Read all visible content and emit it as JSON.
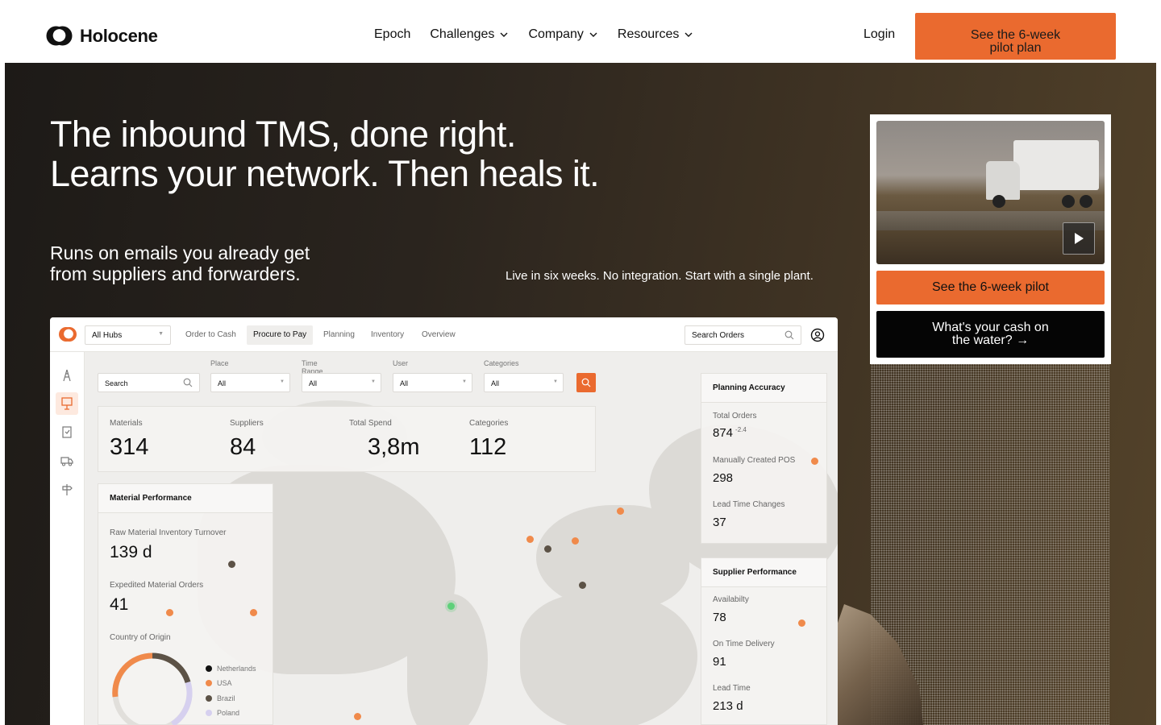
{
  "brand": {
    "name": "Holocene"
  },
  "nav": {
    "links": [
      {
        "label": "Epoch"
      },
      {
        "label": "Challenges"
      },
      {
        "label": "Company"
      },
      {
        "label": "Resources"
      }
    ],
    "login": "Login",
    "cta": [
      "See the 6-week",
      "pilot plan"
    ]
  },
  "hero": {
    "headline": [
      "The inbound TMS, done right.",
      "Learns your network. Then heals it."
    ],
    "sub_left": [
      "Runs on emails you already get",
      "from suppliers and forwarders."
    ],
    "sub_right": "Live in six weeks. No integration. Start with a single plant."
  },
  "video_card": {
    "primary_button": "See the 6-week pilot",
    "secondary_button": [
      "What's your cash on",
      "the water? →"
    ]
  },
  "dashboard": {
    "hub_select": "All Hubs",
    "tabs": [
      "Order to Cash",
      "Procure to Pay",
      "Planning",
      "Inventory",
      "Overview"
    ],
    "active_tab": "Procure to Pay",
    "search_placeholder": "Search Orders",
    "filters": {
      "search": "Search",
      "place": {
        "label": "Place",
        "value": "All"
      },
      "time_range": {
        "label": "Time Range",
        "value": "All"
      },
      "user": {
        "label": "User",
        "value": "All"
      },
      "categories": {
        "label": "Categories",
        "value": "All"
      }
    },
    "kpis": [
      {
        "label": "Materials",
        "value": "314"
      },
      {
        "label": "Suppliers",
        "value": "84"
      },
      {
        "label": "Total Spend",
        "value": "3,8m"
      },
      {
        "label": "Categories",
        "value": "112"
      }
    ],
    "material_performance": {
      "title": "Material Performance",
      "metrics": [
        {
          "label": "Raw Material Inventory Turnover",
          "value": "139 d"
        },
        {
          "label": "Expedited Material Orders",
          "value": "41"
        }
      ],
      "country_label": "Country of Origin",
      "countries": [
        "Netherlands",
        "USA",
        "Brazil",
        "Poland"
      ]
    },
    "planning_accuracy": {
      "title": "Planning Accuracy",
      "metrics": [
        {
          "label": "Total Orders",
          "value": "874",
          "delta": "-2.4"
        },
        {
          "label": "Manually Created POS",
          "value": "298"
        },
        {
          "label": "Lead Time Changes",
          "value": "37"
        }
      ]
    },
    "supplier_performance": {
      "title": "Supplier Performance",
      "metrics": [
        {
          "label": "Availabilty",
          "value": "78"
        },
        {
          "label": "On Time Delivery",
          "value": "91"
        },
        {
          "label": "Lead Time",
          "value": "213 d"
        }
      ]
    }
  },
  "colors": {
    "accent": "#ea6a2f",
    "dark": "#050505",
    "hero_bg": "#2a241e"
  },
  "icons": [
    "holocene-logo-icon",
    "chevron-down-icon",
    "play-icon",
    "search-icon",
    "user-icon",
    "tower-icon",
    "presentation-icon",
    "clipboard-icon",
    "truck-icon",
    "signpost-icon"
  ]
}
